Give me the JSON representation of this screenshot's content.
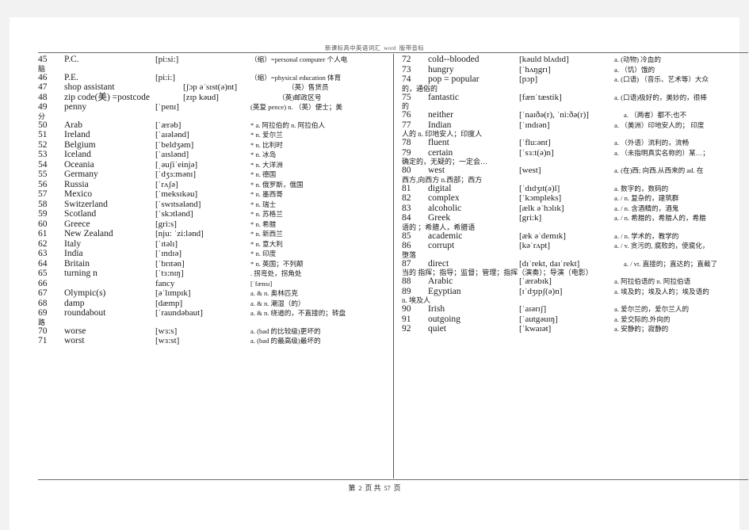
{
  "header": {
    "title_cn": "新课标高中英语词汇",
    "title_word": "word",
    "title_cn2": "版带音标"
  },
  "footer": {
    "prefix": "第",
    "page": "2",
    "mid": "页 共",
    "total": "57",
    "suffix": "页"
  },
  "left_column": [
    {
      "num": "45",
      "word": "P.C.",
      "phon": "[pi:si:]",
      "def": "（缩）=personal computer 个人电",
      "wrap": "脑"
    },
    {
      "num": "46",
      "word": "P.E.",
      "phon": "[pi:i:]",
      "def": "（缩）=physical education 体育",
      "wrap": ""
    },
    {
      "num": "47",
      "word": "shop assistant",
      "phon": "[ʃɔp əˈsɪst(ə)nt]",
      "def": "（英）售货员",
      "wrap": ""
    },
    {
      "num": "48",
      "word": "zip code(美) =postcode",
      "phon": "[zɪp kəud]",
      "def": "（英)邮政区号",
      "wrap": ""
    },
    {
      "num": "49",
      "word": "penny",
      "phon": "[ˈpenɪ]",
      "def": "(英复 pence) n. （英）便士；美",
      "wrap": "分"
    },
    {
      "num": "50",
      "word": "Arab",
      "phon": "[ˈærəb]",
      "def": "* a. 阿拉伯的 n. 阿拉伯人",
      "wrap": ""
    },
    {
      "num": "51",
      "word": "Ireland",
      "phon": "[ˈaɪələnd]",
      "def": "* n. 爱尔兰",
      "wrap": ""
    },
    {
      "num": "52",
      "word": "Belgium",
      "phon": "[ˈbeldʒəm]",
      "def": "* n. 比利时",
      "wrap": ""
    },
    {
      "num": "53",
      "word": "Iceland",
      "phon": "[ˈaɪslənd]",
      "def": "* n. 冰岛",
      "wrap": ""
    },
    {
      "num": "54",
      "word": "Oceania",
      "phon": "[ˌəuʃiˈeinjə]",
      "def": "* n. 大洋洲",
      "wrap": ""
    },
    {
      "num": "55",
      "word": "Germany",
      "phon": "[ˈdʒɜ:mənɪ]",
      "def": "* n. 德国",
      "wrap": ""
    },
    {
      "num": "56",
      "word": "Russia",
      "phon": "[ˈrʌʃə]",
      "def": "* n. 俄罗斯，俄国",
      "wrap": ""
    },
    {
      "num": "57",
      "word": "Mexico",
      "phon": "[ˈmeksɪkəu]",
      "def": "* n. 墨西哥",
      "wrap": ""
    },
    {
      "num": "58",
      "word": "Switzerland",
      "phon": "[ˈswɪtsələnd]",
      "def": "* n. 瑞士",
      "wrap": ""
    },
    {
      "num": "59",
      "word": "Scotland",
      "phon": "[ˈskɔtlənd]",
      "def": "* n. 苏格兰",
      "wrap": ""
    },
    {
      "num": "60",
      "word": "Greece",
      "phon": "[gri:s]",
      "def": "* n. 希腊",
      "wrap": ""
    },
    {
      "num": "61",
      "word": "New Zealand",
      "phon": "[nju: ˈzi:lənd]",
      "def": "* n. 新西兰",
      "wrap": ""
    },
    {
      "num": "62",
      "word": "Italy",
      "phon": "[ˈɪtəlɪ]",
      "def": "* n. 意大利",
      "wrap": ""
    },
    {
      "num": "63",
      "word": "India",
      "phon": "[ˈɪndɪə]",
      "def": "* n. 印度",
      "wrap": ""
    },
    {
      "num": "64",
      "word": "Britain",
      "phon": "[ˈbrɪtən]",
      "def": "* n. 英国；不列颠",
      "wrap": ""
    },
    {
      "num": "65",
      "word": "turning n",
      "phon": "[ˈtɜ:nɪŋ]",
      "def": ". 拐弯处，拐角处",
      "wrap": ""
    },
    {
      "num": "66",
      "word": "",
      "phon": "fancy",
      "def": "[ˈfænsɪ]",
      "wrap": ""
    },
    {
      "num": "67",
      "word": "Olympic(s)",
      "phon": "[əˈlɪmpɪk]",
      "def": "a. & n. 奥林匹克",
      "wrap": ""
    },
    {
      "num": "68",
      "word": "damp",
      "phon": "[dæmp]",
      "def": "a. & n. 潮湿（的）",
      "wrap": ""
    },
    {
      "num": "69",
      "word": "roundabout",
      "phon": "[ˈraundəbaut]",
      "def": "a. & n. 绕道的，不直接的；转盘",
      "wrap": "路"
    },
    {
      "num": "70",
      "word": "worse",
      "phon": "[wɜ:s]",
      "def": "a. (bad 的比较级)更坏的",
      "wrap": ""
    },
    {
      "num": "71",
      "word": "worst",
      "phon": "[wɜ:st]",
      "def": "a. (bad 的最高级)最坏的",
      "wrap": ""
    }
  ],
  "right_column": [
    {
      "num": "72",
      "word": "cold--blooded",
      "phon": "[kəuld blʌdɪd]",
      "def": "a. (动物) 冷血的",
      "wrap": ""
    },
    {
      "num": "73",
      "word": "hungry",
      "phon": "[ˈhʌŋgrɪ]",
      "def": "a. （饥）饿的",
      "wrap": ""
    },
    {
      "num": "74",
      "word": "pop = popular",
      "phon": "[pɔp]",
      "def": "a. (口语) （音乐、艺术等）大众",
      "wrap": "的，通俗的"
    },
    {
      "num": "75",
      "word": "fantastic",
      "phon": "[fænˈtæstik]",
      "def": "a. (口语)极好的，美妙的，很棒",
      "wrap": "的"
    },
    {
      "num": "76",
      "word": "neither",
      "phon": "[ˈnaɪðə(r), ˈni:ðə(r)]",
      "def": "a. （两者）都不;也不",
      "wrap": ""
    },
    {
      "num": "77",
      "word": "Indian",
      "phon": "[ˈɪndɪən]",
      "def": "a. （美洲）印地安人的； 印度",
      "wrap": "人的 n. 印地安人；印度人"
    },
    {
      "num": "78",
      "word": "fluent",
      "phon": "[ˈflu:ənt]",
      "def": "a. （外语）流利的，流畅",
      "wrap": ""
    },
    {
      "num": "79",
      "word": "certain",
      "phon": "[ˈsɜ:t(ə)n]",
      "def": "a. （未指明真实名称的）某…；",
      "wrap": "确定的，无疑的；一定会…"
    },
    {
      "num": "80",
      "word": "west",
      "phon": "[west]",
      "def": "a. (在)西; 向西.从西来的 ad. 在",
      "wrap": "西方,向西方 n.西部；西方"
    },
    {
      "num": "81",
      "word": "digital",
      "phon": "[ˈdɪdʒɪt(ə)l]",
      "def": "a. 数字的，数码的",
      "wrap": ""
    },
    {
      "num": "82",
      "word": "complex",
      "phon": "[ˈkɔmpleks]",
      "def": "a. / n. 复杂的，建筑群",
      "wrap": ""
    },
    {
      "num": "83",
      "word": "alcoholic",
      "phon": "[ælk əˈhɔlɪk]",
      "def": "a. / n. 含酒精的，酒鬼",
      "wrap": ""
    },
    {
      "num": "84",
      "word": "Greek",
      "phon": "[gri:k]",
      "def": "a. / n. 希腊的，希腊人的，希腊",
      "wrap": "语的 ；希腊人，希腊语"
    },
    {
      "num": "85",
      "word": "academic",
      "phon": "[æk əˈdemɪk]",
      "def": "a. / n. 学术的，教学的",
      "wrap": ""
    },
    {
      "num": "86",
      "word": "corrupt",
      "phon": "[kəˈrʌpt]",
      "def": "a. / v. 贪污的, 腐败的，使腐化，",
      "wrap": "堕落"
    },
    {
      "num": "87",
      "word": "direct",
      "phon": "[dɪˈrekt, daɪˈrekt]",
      "def": "a. / vt. 直接的；直达的；直截了",
      "wrap": "当的 指挥；指导；监督；管理；指挥（演奏）；导演（电影）"
    },
    {
      "num": "88",
      "word": "Arabic",
      "phon": "[ˈærəbɪk]",
      "def": "a. 阿拉伯语的 n. 阿拉伯语",
      "wrap": ""
    },
    {
      "num": "89",
      "word": "Egyptian",
      "phon": "[ɪˈdʒɪpʃ(ə)n]",
      "def": "a. 埃及的；埃及人的；埃及语的",
      "wrap": "n. 埃及人"
    },
    {
      "num": "90",
      "word": "Irish",
      "phon": "[ˈaɪərɪʃ]",
      "def": "a. 爱尔兰的，爱尔兰人的",
      "wrap": ""
    },
    {
      "num": "91",
      "word": "outgoing",
      "phon": "[ˈautgəuɪŋ]",
      "def": "a. 爱交际的.外向的",
      "wrap": ""
    },
    {
      "num": "92",
      "word": "quiet",
      "phon": "[ˈkwaɪət]",
      "def": "a. 安静的；寂静的",
      "wrap": ""
    }
  ]
}
